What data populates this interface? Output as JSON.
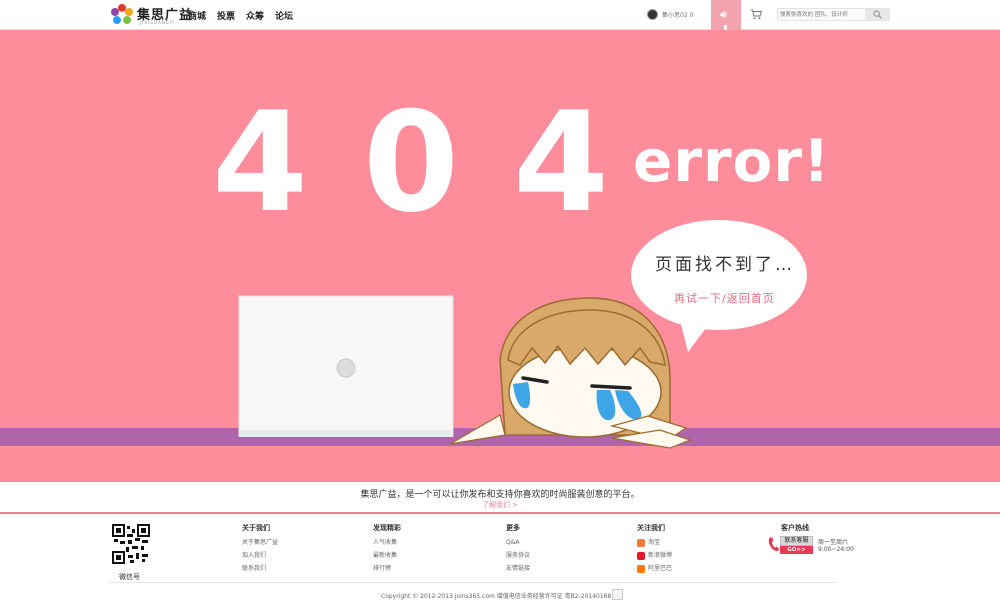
{
  "header": {
    "logo_text": "集思广益",
    "logo_sub": "JISIGUANGYI",
    "nav": [
      "商城",
      "投票",
      "众筹",
      "论坛"
    ],
    "user_name": "集小思02 0",
    "search_placeholder": "搜索你喜欢的 团队、设计师"
  },
  "error": {
    "digits": [
      "4",
      "0",
      "4"
    ],
    "word": "error!",
    "bubble_title": "页面找不到了…",
    "bubble_link": "再试一下/返回首页"
  },
  "slogan": {
    "text": "集思广益，是一个可以让你发布和支持你喜欢的时尚服装创意的平台。",
    "link": "了解我们 >"
  },
  "footer": {
    "qr_label": "微信号",
    "columns": [
      {
        "head": "关于我们",
        "items": [
          "关于集思广益",
          "加入我们",
          "联系我们"
        ]
      },
      {
        "head": "发现精彩",
        "items": [
          "人气收集",
          "最新收集",
          "排行榜"
        ]
      },
      {
        "head": "更多",
        "items": [
          "Q&A",
          "服务协议",
          "友情链接"
        ]
      },
      {
        "head": "关注我们",
        "items": [
          "淘宝",
          "新浪微博",
          "阿里巴巴"
        ]
      }
    ],
    "hotline": {
      "head": "客户热线",
      "button": "联系客服",
      "go": "GO>>",
      "hours_days": "周一至周六",
      "hours_time": "9:00~24:00"
    },
    "copyright": "Copyright © 2012-2013 joins365.com  增值电信业务经营许可证 粤B2-20140168"
  },
  "colors": {
    "hero_bg": "#fe8d9b",
    "desk": "#b065ab",
    "accent": "#f07d90"
  }
}
